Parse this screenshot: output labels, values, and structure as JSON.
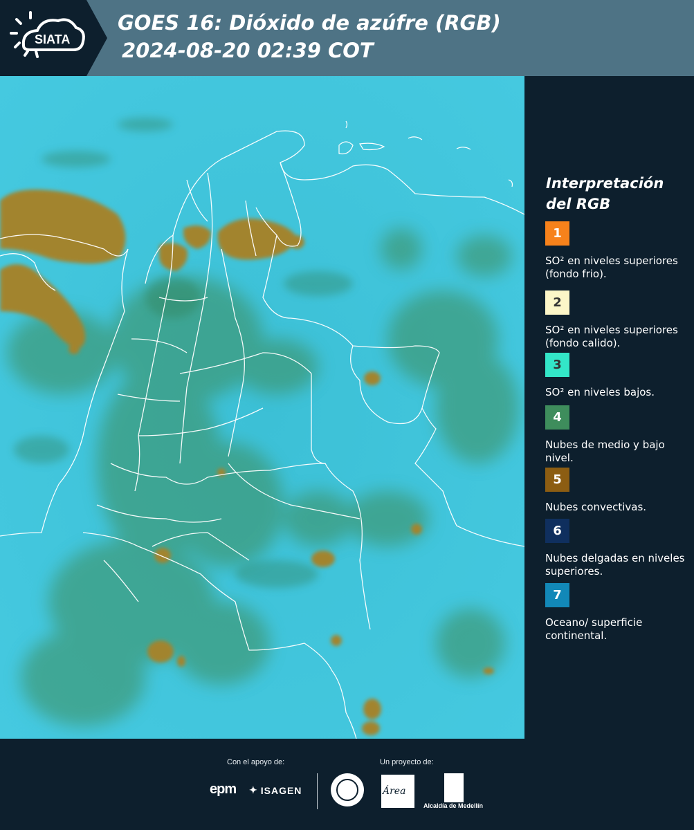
{
  "header": {
    "logo_text": "SIATA",
    "title": "GOES 16: Dióxido de azúfre (RGB)",
    "subtitle": "2024-08-20 02:39 COT"
  },
  "legend": {
    "title": "Interpretación del RGB",
    "items": [
      {
        "number": "1",
        "color": "#f7821b",
        "text_color": "#ffffff",
        "label": "SO² en niveles superiores (fondo frio)."
      },
      {
        "number": "2",
        "color": "#fcf6c8",
        "text_color": "#333333",
        "label": "SO² en niveles superiores (fondo calido)."
      },
      {
        "number": "3",
        "color": "#33e6c8",
        "text_color": "#333333",
        "label": "SO² en niveles bajos."
      },
      {
        "number": "4",
        "color": "#3e8d5c",
        "text_color": "#ffffff",
        "label": "Nubes de medio y bajo nivel."
      },
      {
        "number": "5",
        "color": "#8c5d12",
        "text_color": "#ffffff",
        "label": "Nubes convectivas."
      },
      {
        "number": "6",
        "color": "#0f2f5e",
        "text_color": "#ffffff",
        "label": "Nubes delgadas en niveles superiores."
      },
      {
        "number": "7",
        "color": "#1288b8",
        "text_color": "#ffffff",
        "label": "Oceano/ superficie continental."
      }
    ]
  },
  "footer": {
    "support_label": "Con el apoyo de:",
    "project_label": "Un proyecto de:",
    "sponsor_1": "epm",
    "sponsor_2": "ISAGEN",
    "area_logo_text": "Área",
    "alcaldia_text": "Alcaldía de Medellín"
  },
  "colors": {
    "background": "#0d1f2d",
    "header_band": "#4e7385",
    "surface": "#3cc4db",
    "low_clouds": "#3e8d5c",
    "convective": "#a2842e"
  }
}
